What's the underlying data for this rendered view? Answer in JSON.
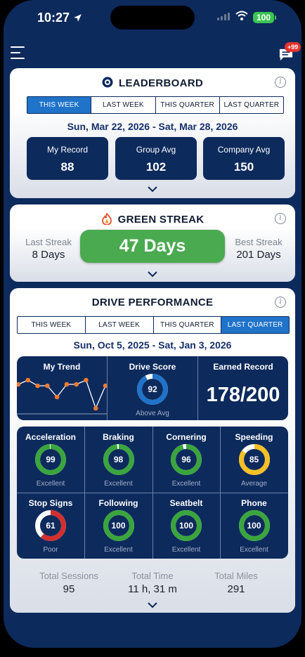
{
  "status_bar": {
    "time": "10:27",
    "battery": "100"
  },
  "header": {
    "notifications_badge": "+99"
  },
  "leaderboard": {
    "title": "LEADERBOARD",
    "tabs": [
      "THIS WEEK",
      "LAST WEEK",
      "THIS QUARTER",
      "LAST QUARTER"
    ],
    "active_tab": "THIS WEEK",
    "date_range": "Sun, Mar 22, 2026 - Sat, Mar 28, 2026",
    "stats": [
      {
        "label": "My Record",
        "value": "88"
      },
      {
        "label": "Group Avg",
        "value": "102"
      },
      {
        "label": "Company Avg",
        "value": "150"
      }
    ]
  },
  "green_streak": {
    "title": "GREEN STREAK",
    "last_streak_label": "Last Streak",
    "last_streak_value": "8 Days",
    "current": "47 Days",
    "best_streak_label": "Best Streak",
    "best_streak_value": "201 Days"
  },
  "drive_performance": {
    "title": "DRIVE PERFORMANCE",
    "tabs": [
      "THIS WEEK",
      "LAST WEEK",
      "THIS QUARTER",
      "LAST QUARTER"
    ],
    "active_tab": "LAST QUARTER",
    "date_range": "Sun, Oct 5, 2025 - Sat, Jan 3, 2026",
    "my_trend": {
      "label": "My Trend",
      "points": [
        95,
        98,
        94,
        94,
        86,
        95,
        95,
        98,
        78,
        94
      ]
    },
    "drive_score": {
      "label": "Drive Score",
      "value": "92",
      "sub": "Above Avg"
    },
    "earned_record": {
      "label": "Earned Record",
      "value": "178/200"
    },
    "metrics": [
      {
        "label": "Acceleration",
        "value": "99",
        "rating": "Excellent",
        "color": "#3aa53e"
      },
      {
        "label": "Braking",
        "value": "98",
        "rating": "Excellent",
        "color": "#3aa53e"
      },
      {
        "label": "Cornering",
        "value": "96",
        "rating": "Excellent",
        "color": "#3aa53e"
      },
      {
        "label": "Speeding",
        "value": "85",
        "rating": "Average",
        "color": "#f4c026"
      },
      {
        "label": "Stop Signs",
        "value": "61",
        "rating": "Poor",
        "color": "#d1302f"
      },
      {
        "label": "Following",
        "value": "100",
        "rating": "Excellent",
        "color": "#3aa53e"
      },
      {
        "label": "Seatbelt",
        "value": "100",
        "rating": "Excellent",
        "color": "#3aa53e"
      },
      {
        "label": "Phone",
        "value": "100",
        "rating": "Excellent",
        "color": "#3aa53e"
      }
    ],
    "totals": [
      {
        "label": "Total Sessions",
        "value": "95"
      },
      {
        "label": "Total Time",
        "value": "11 h, 31 m"
      },
      {
        "label": "Total Miles",
        "value": "291"
      }
    ]
  },
  "colors": {
    "navy": "#0d2a5c",
    "accent_blue": "#1f73c9",
    "green": "#4aaa50"
  }
}
